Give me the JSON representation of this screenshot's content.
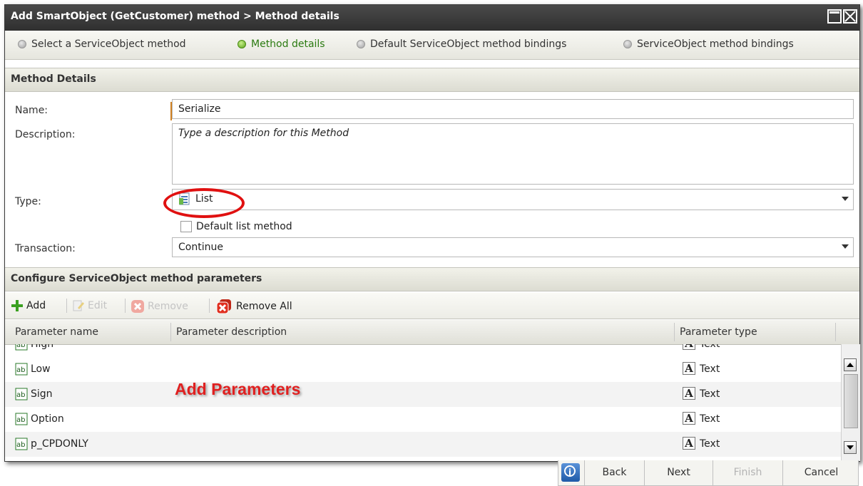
{
  "window": {
    "title": "Add SmartObject (GetCustomer) method > Method details"
  },
  "wizard": {
    "steps": [
      {
        "label": "Select a ServiceObject method",
        "active": false
      },
      {
        "label": "Method details",
        "active": true
      },
      {
        "label": "Default ServiceObject method bindings",
        "active": false
      },
      {
        "label": "ServiceObject method bindings",
        "active": false
      }
    ]
  },
  "method_details": {
    "header": "Method Details",
    "name_label": "Name:",
    "name_value": "Serialize",
    "description_label": "Description:",
    "description_placeholder": "Type a description for this Method",
    "type_label": "Type:",
    "type_value": "List",
    "default_list_label": "Default list method",
    "transaction_label": "Transaction:",
    "transaction_value": "Continue"
  },
  "parameters": {
    "header": "Configure ServiceObject method parameters",
    "toolbar": {
      "add": "Add",
      "edit": "Edit",
      "remove": "Remove",
      "remove_all": "Remove All"
    },
    "columns": [
      "Parameter name",
      "Parameter description",
      "Parameter type"
    ],
    "rows": [
      {
        "name": "High",
        "description": "",
        "type": "Text"
      },
      {
        "name": "Low",
        "description": "",
        "type": "Text"
      },
      {
        "name": "Sign",
        "description": "",
        "type": "Text"
      },
      {
        "name": "Option",
        "description": "",
        "type": "Text"
      },
      {
        "name": "p_CPDONLY",
        "description": "",
        "type": "Text"
      }
    ],
    "annotation": "Add Parameters"
  },
  "footer": {
    "back": "Back",
    "next": "Next",
    "finish": "Finish",
    "cancel": "Cancel"
  },
  "colors": {
    "titlebar": "#3a3a3a",
    "active_step": "#5aa21a",
    "annotation": "#e02020"
  }
}
